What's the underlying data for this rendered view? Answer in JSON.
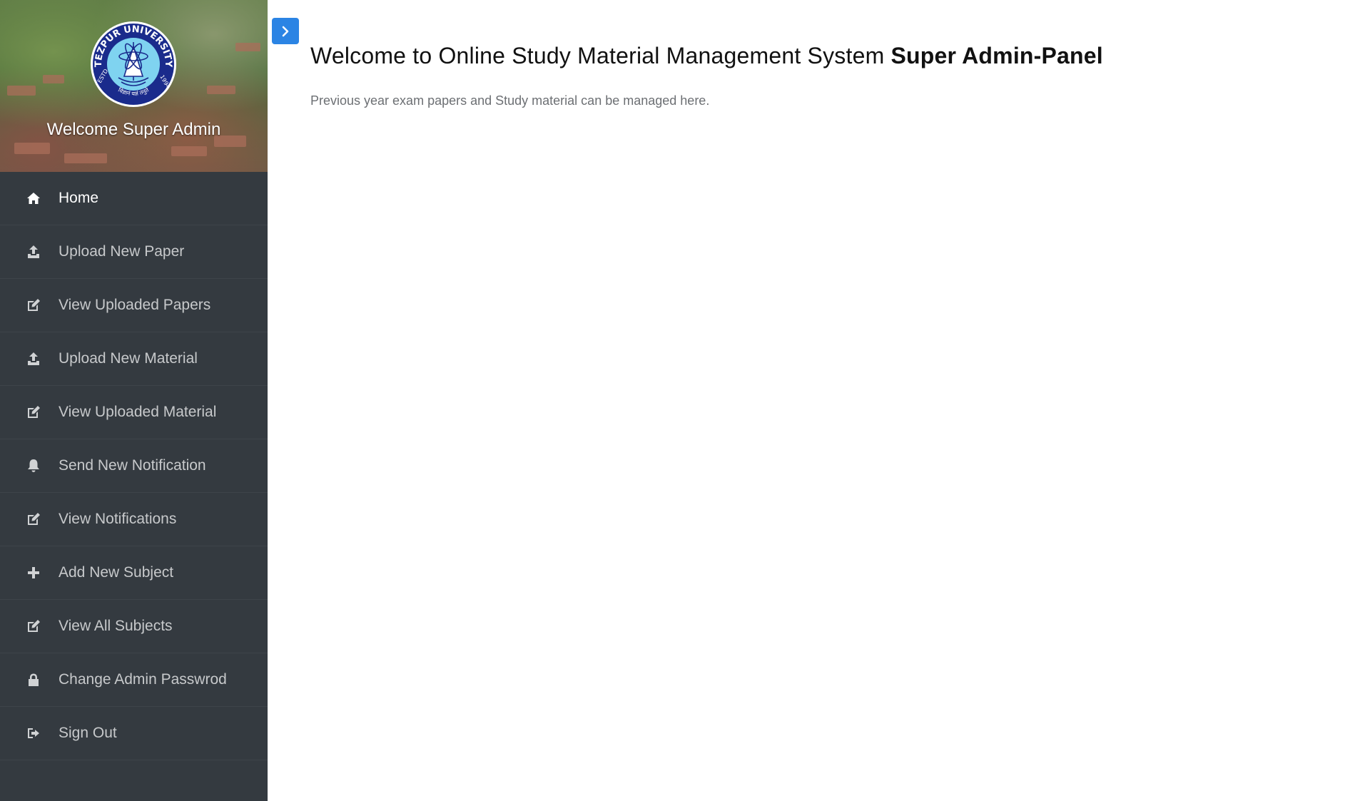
{
  "sidebar": {
    "welcome_text": "Welcome Super Admin",
    "logo": {
      "ring_text": "TEZPUR UNIVERSITY",
      "estd": "ESTD",
      "year": "1994",
      "motto": "विज्ञानं यज्ञं तनुते"
    },
    "items": [
      {
        "label": "Home",
        "icon": "home-icon"
      },
      {
        "label": "Upload New Paper",
        "icon": "upload-icon"
      },
      {
        "label": "View Uploaded Papers",
        "icon": "edit-icon"
      },
      {
        "label": "Upload New Material",
        "icon": "upload-icon"
      },
      {
        "label": "View Uploaded Material",
        "icon": "edit-icon"
      },
      {
        "label": "Send New Notification",
        "icon": "bell-icon"
      },
      {
        "label": "View Notifications",
        "icon": "edit-icon"
      },
      {
        "label": "Add New Subject",
        "icon": "plus-icon"
      },
      {
        "label": "View All Subjects",
        "icon": "edit-icon"
      },
      {
        "label": "Change Admin Passwrod",
        "icon": "lock-icon"
      },
      {
        "label": "Sign Out",
        "icon": "sign-out-icon"
      }
    ]
  },
  "toggle": {
    "icon": "chevron-right-icon"
  },
  "main": {
    "title_prefix": "Welcome to Online Study Material Management System ",
    "title_bold": "Super Admin-Panel",
    "description": "Previous year exam papers and Study material can be managed here."
  },
  "colors": {
    "sidebar_bg": "#343a40",
    "accent": "#2b84e4",
    "logo_blue": "#1a2b8c",
    "logo_light": "#7fd3f0"
  }
}
